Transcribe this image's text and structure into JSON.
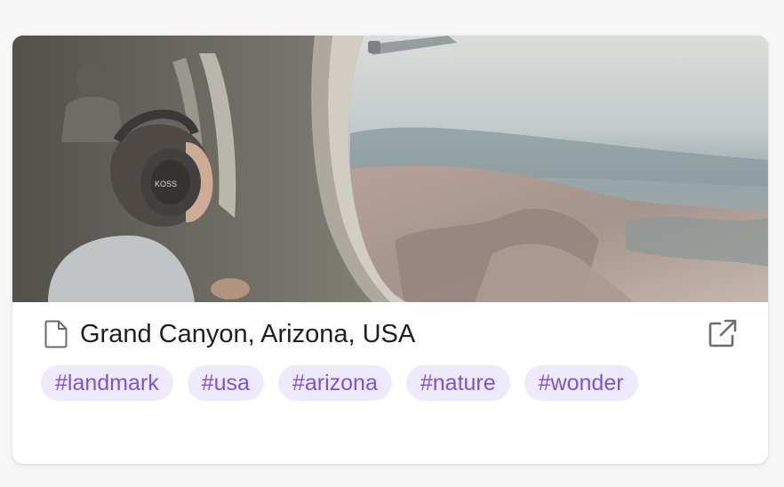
{
  "card": {
    "title": "Grand Canyon, Arizona, USA",
    "image_alt": "Child wearing headphones looking out an airplane window at the Grand Canyon",
    "headphone_brand": "KOSS",
    "tags": [
      "#landmark",
      "#usa",
      "#arizona",
      "#nature",
      "#wonder"
    ],
    "icons": {
      "title_icon": "document-icon",
      "link_icon": "external-link-icon"
    }
  },
  "colors": {
    "tag_background": "#efeafb",
    "tag_text": "#7a53db",
    "title_text": "#1f1f1f",
    "icon_gray": "#6b6b6b"
  }
}
